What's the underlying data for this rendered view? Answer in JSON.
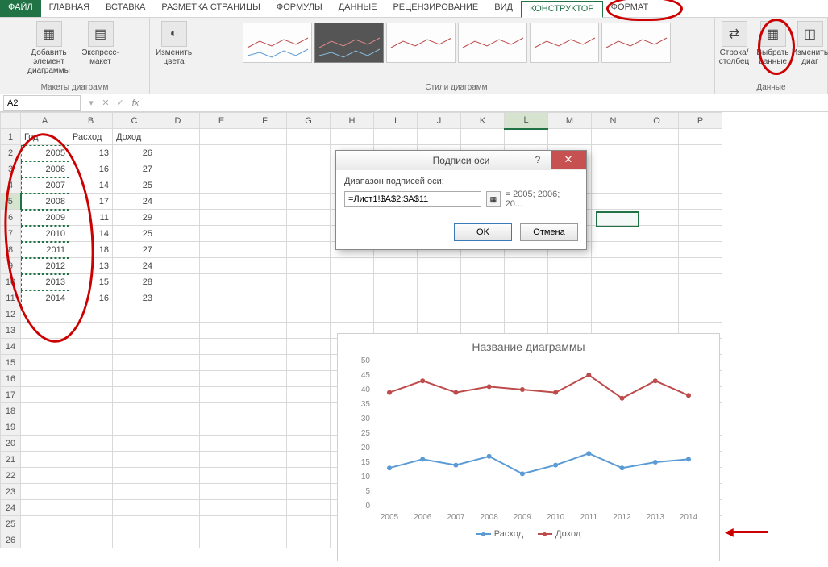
{
  "tabs": {
    "file": "ФАЙЛ",
    "items": [
      "ГЛАВНАЯ",
      "ВСТАВКА",
      "РАЗМЕТКА СТРАНИЦЫ",
      "ФОРМУЛЫ",
      "ДАННЫЕ",
      "РЕЦЕНЗИРОВАНИЕ",
      "ВИД",
      "КОНСТРУКТОР",
      "ФОРМАТ"
    ],
    "active": "КОНСТРУКТОР"
  },
  "ribbon": {
    "add_element": "Добавить элемент диаграммы",
    "express": "Экспресс-макет",
    "change_colors": "Изменить цвета",
    "group_layouts": "Макеты диаграмм",
    "group_styles": "Стили диаграмм",
    "row_col": "Строка/столбец",
    "select_data": "Выбрать данные",
    "change_type": "Изменить тип диаграммы",
    "group_data": "Данные"
  },
  "namebox": "A2",
  "headers": {
    "A": "Год",
    "B": "Расход",
    "C": "Доход"
  },
  "cols": [
    "A",
    "B",
    "C",
    "D",
    "E",
    "F",
    "G",
    "H",
    "I",
    "J",
    "K",
    "L",
    "M",
    "N",
    "O",
    "P"
  ],
  "rows": [
    {
      "n": 1,
      "A": "Год",
      "B": "Расход",
      "C": "Доход"
    },
    {
      "n": 2,
      "A": 2005,
      "B": 13,
      "C": 26
    },
    {
      "n": 3,
      "A": 2006,
      "B": 16,
      "C": 27
    },
    {
      "n": 4,
      "A": 2007,
      "B": 14,
      "C": 25
    },
    {
      "n": 5,
      "A": 2008,
      "B": 17,
      "C": 24
    },
    {
      "n": 6,
      "A": 2009,
      "B": 11,
      "C": 29
    },
    {
      "n": 7,
      "A": 2010,
      "B": 14,
      "C": 25
    },
    {
      "n": 8,
      "A": 2011,
      "B": 18,
      "C": 27
    },
    {
      "n": 9,
      "A": 2012,
      "B": 13,
      "C": 24
    },
    {
      "n": 10,
      "A": 2013,
      "B": 15,
      "C": 28
    },
    {
      "n": 11,
      "A": 2014,
      "B": 16,
      "C": 23
    }
  ],
  "dialog": {
    "title": "Подписи оси",
    "label_range": "Диапазон подписей оси:",
    "input": "=Лист1!$A$2:$A$11",
    "preview": "= 2005; 2006; 20...",
    "ok": "OK",
    "cancel": "Отмена"
  },
  "chart_data": {
    "type": "line",
    "title": "Название диаграммы",
    "categories": [
      2005,
      2006,
      2007,
      2008,
      2009,
      2010,
      2011,
      2012,
      2013,
      2014
    ],
    "series": [
      {
        "name": "Расход",
        "color": "#5b9bd5",
        "values": [
          13,
          16,
          14,
          17,
          11,
          14,
          18,
          13,
          15,
          16
        ]
      },
      {
        "name": "Доход",
        "color": "#bd4b4b",
        "values": [
          39,
          43,
          39,
          41,
          40,
          39,
          45,
          37,
          43,
          38
        ]
      }
    ],
    "ylim": [
      0,
      50
    ],
    "ystep": 5,
    "xlabel": "",
    "ylabel": ""
  }
}
